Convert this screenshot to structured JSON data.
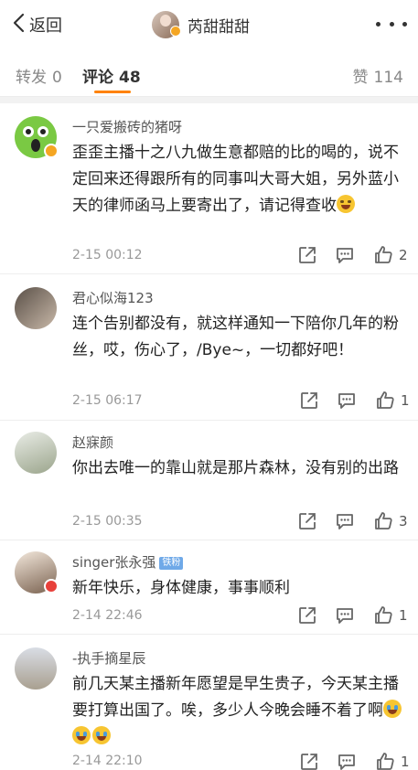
{
  "navbar": {
    "back_label": "返回",
    "user_name": "芮甜甜甜"
  },
  "tabs": {
    "repost_label": "转发",
    "repost_count": "0",
    "comment_label": "评论",
    "comment_count": "48",
    "like_label": "赞",
    "like_count": "114",
    "active_color": "#ff8200"
  },
  "comments": [
    {
      "user": "一只爱搬砖的猪呀",
      "text": "歪歪主播十之八九做生意都赔的比的喝的，说不定回来还得跟所有的同事叫大哥大姐，另外蓝小天的律师函马上要寄出了，请记得查收",
      "emoji": [
        "laugh-emoji"
      ],
      "time": "2-15 00:12",
      "likes": "2",
      "avatar_badge": "vip"
    },
    {
      "user": "君心似海123",
      "text": "连个告别都没有，就这样通知一下陪你几年的粉丝，哎，伤心了，/Bye~，一切都好吧！",
      "time": "2-15 06:17",
      "likes": "1"
    },
    {
      "user": "赵寐颜",
      "text": "你出去唯一的靠山就是那片森林，没有别的出路",
      "time": "2-15 00:35",
      "likes": "3"
    },
    {
      "user": "singer张永强",
      "fan_badge": "铁粉",
      "text": "新年快乐，身体健康，事事顺利",
      "time": "2-14 22:46",
      "likes": "1",
      "avatar_badge": "red"
    },
    {
      "user": "-执手摘星辰",
      "text": "前几天某主播新年愿望是早生贵子，今天某主播要打算出国了。唉，多少人今晚会睡不着了啊",
      "emoji": [
        "crying-emoji",
        "crying-emoji",
        "crying-emoji"
      ],
      "time": "2-14 22:10",
      "likes": "1"
    }
  ]
}
